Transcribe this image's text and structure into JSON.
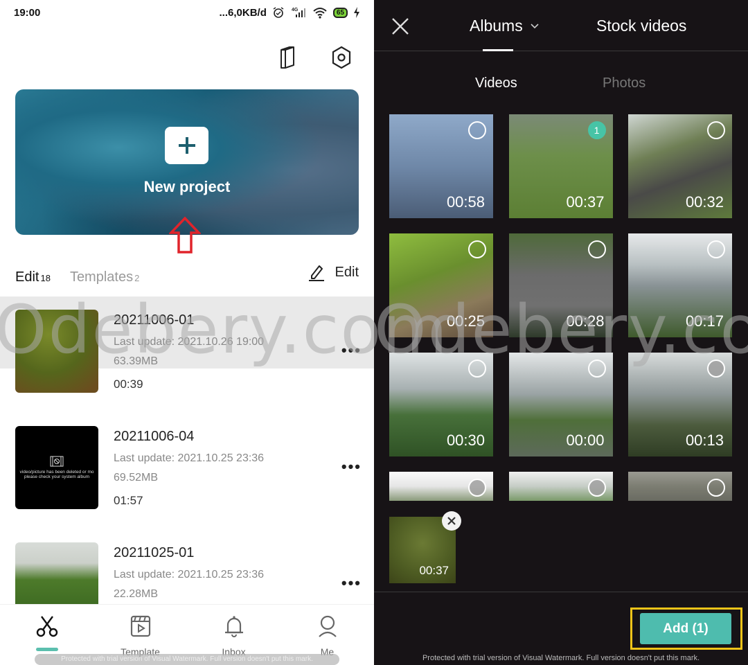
{
  "status_bar": {
    "time": "19:00",
    "network_speed": "...6,0KB/d",
    "network_type": "4G",
    "battery": "65"
  },
  "home": {
    "top_icons": [
      "book-icon",
      "settings-hex-icon"
    ],
    "new_project_label": "New project",
    "tabs": [
      {
        "label": "Edit",
        "count": "18",
        "active": true
      },
      {
        "label": "Templates",
        "count": "2",
        "active": false
      }
    ],
    "edit_button": "Edit",
    "projects": [
      {
        "name": "20211006-01",
        "last_update": "Last update: 2021.10.26 19:00",
        "size": "63.39MB",
        "duration": "00:39"
      },
      {
        "name": "20211006-04",
        "last_update": "Last update: 2021.10.25 23:36",
        "size": "69.52MB",
        "duration": "01:57",
        "thumb_message": "video/picture has been deleted or mo please check your system album"
      },
      {
        "name": "20211025-01",
        "last_update": "Last update: 2021.10.25 23:36",
        "size": "22.28MB",
        "duration": ""
      }
    ],
    "more_label": "•••",
    "bottom_nav": [
      {
        "label": "",
        "icon": "scissors-icon",
        "active": true
      },
      {
        "label": "Template",
        "icon": "template-icon",
        "active": false
      },
      {
        "label": "Inbox",
        "icon": "bell-icon",
        "active": false
      },
      {
        "label": "Me",
        "icon": "person-icon",
        "active": false
      }
    ],
    "trial_text": "Protected with trial version of Visual Watermark. Full version doesn't put this mark."
  },
  "watermark": "Odebery.com",
  "picker": {
    "tabs": [
      {
        "label": "Albums",
        "active": true
      },
      {
        "label": "Stock videos",
        "active": false
      }
    ],
    "subtabs": [
      {
        "label": "Videos",
        "active": true
      },
      {
        "label": "Photos",
        "active": false
      }
    ],
    "videos": [
      {
        "duration": "00:58",
        "selected": false,
        "order": ""
      },
      {
        "duration": "00:37",
        "selected": true,
        "order": "1"
      },
      {
        "duration": "00:32",
        "selected": false,
        "order": ""
      },
      {
        "duration": "00:25",
        "selected": false,
        "order": ""
      },
      {
        "duration": "00:28",
        "selected": false,
        "order": ""
      },
      {
        "duration": "00:17",
        "selected": false,
        "order": ""
      },
      {
        "duration": "00:30",
        "selected": false,
        "order": ""
      },
      {
        "duration": "00:00",
        "selected": false,
        "order": ""
      },
      {
        "duration": "00:13",
        "selected": false,
        "order": ""
      },
      {
        "duration": "",
        "selected": false,
        "order": ""
      },
      {
        "duration": "",
        "selected": false,
        "order": ""
      },
      {
        "duration": "",
        "selected": false,
        "order": ""
      }
    ],
    "selected_items": [
      {
        "duration": "00:37"
      }
    ],
    "add_button": "Add (1)",
    "protected_text": "Protected with trial version of Visual Watermark. Full version doesn't put this mark.",
    "accent_color": "#4ebcae",
    "highlight_color": "#f0c419"
  }
}
